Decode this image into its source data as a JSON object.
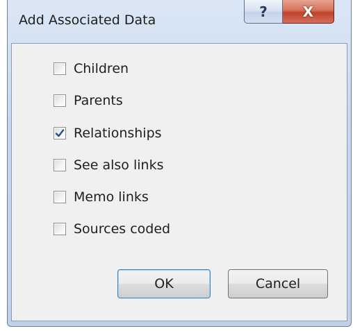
{
  "window": {
    "title": "Add Associated Data",
    "help_label": "?",
    "close_label": "X"
  },
  "options": [
    {
      "label": "Children",
      "checked": false
    },
    {
      "label": "Parents",
      "checked": false
    },
    {
      "label": "Relationships",
      "checked": true
    },
    {
      "label": "See also links",
      "checked": false
    },
    {
      "label": "Memo links",
      "checked": false
    },
    {
      "label": "Sources coded",
      "checked": false
    }
  ],
  "buttons": {
    "ok_label": "OK",
    "cancel_label": "Cancel"
  },
  "colors": {
    "checkmark": "#2a4e8a",
    "close_button": "#c0432b"
  }
}
